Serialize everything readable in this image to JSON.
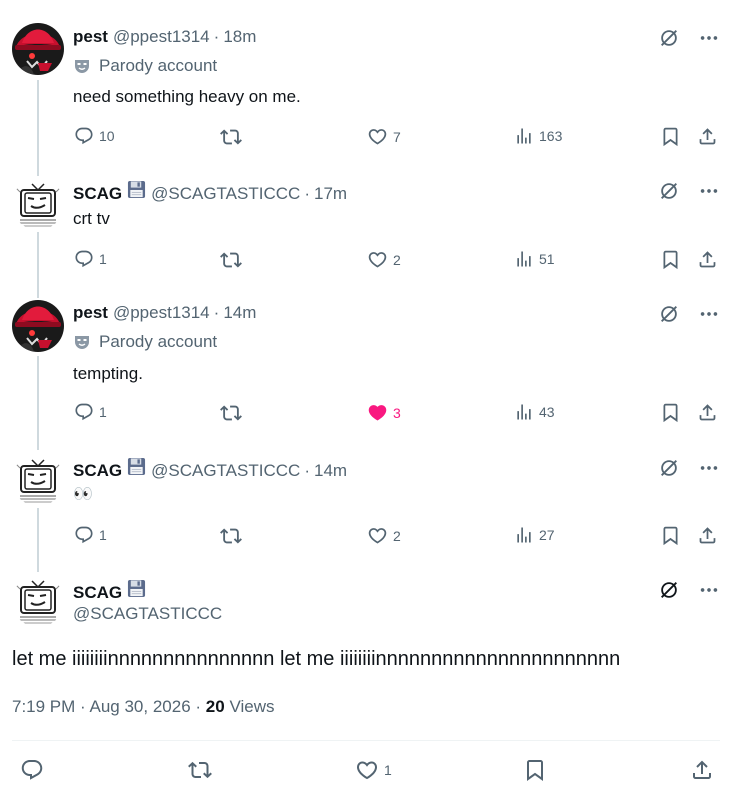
{
  "tweets": [
    {
      "name": "pest",
      "handle": "@ppest1314",
      "time": "18m",
      "parody_label": "Parody account",
      "text": "need something heavy on me.",
      "replies": "10",
      "likes": "7",
      "views": "163",
      "liked": false,
      "avatar": "red-hat-character"
    },
    {
      "name": "SCAG",
      "handle": "@SCAGTASTICCC",
      "time": "17m",
      "text": "crt tv",
      "replies": "1",
      "likes": "2",
      "views": "51",
      "liked": false,
      "avatar": "crt-tv-face"
    },
    {
      "name": "pest",
      "handle": "@ppest1314",
      "time": "14m",
      "parody_label": "Parody account",
      "text": "tempting.",
      "replies": "1",
      "likes": "3",
      "views": "43",
      "liked": true,
      "avatar": "red-hat-character"
    },
    {
      "name": "SCAG",
      "handle": "@SCAGTASTICCC",
      "time": "14m",
      "text": "👀",
      "replies": "1",
      "likes": "2",
      "views": "27",
      "liked": false,
      "avatar": "crt-tv-face"
    }
  ],
  "main_tweet": {
    "name": "SCAG",
    "handle": "@SCAGTASTICCC",
    "text": "let me iiiiiiiinnnnnnnnnnnnnnn let me iiiiiiiinnnnnnnnnnnnnnnnnnnnnn",
    "time": "7:19 PM",
    "date": "Aug 30, 2026",
    "views_count": "20",
    "views_label": "Views",
    "likes": "1"
  },
  "colors": {
    "text": "#0f1419",
    "secondary": "#536471",
    "like_pink": "#f91880",
    "thread_line": "#cfd9de"
  },
  "icons": [
    "grok-icon",
    "more-icon",
    "reply-icon",
    "retweet-icon",
    "like-icon",
    "views-icon",
    "bookmark-icon",
    "share-icon",
    "floppy-disk-icon",
    "parody-mask-icon"
  ]
}
